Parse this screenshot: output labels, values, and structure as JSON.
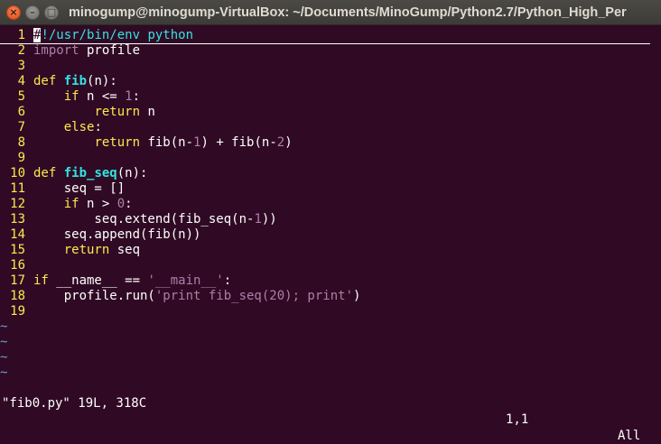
{
  "window": {
    "title": "minogump@minogump-VirtualBox: ~/Documents/MinoGump/Python2.7/Python_High_Per",
    "close_glyph": "×",
    "min_glyph": "–",
    "max_glyph": "□"
  },
  "editor": {
    "lines": [
      {
        "n": "1",
        "segs": [
          {
            "t": "#",
            "c": "cursor"
          },
          {
            "t": "!/usr/bin/env python",
            "c": "comment"
          }
        ]
      },
      {
        "n": "2",
        "segs": [
          {
            "t": "import",
            "c": "kw2"
          },
          {
            "t": " profile",
            "c": ""
          }
        ]
      },
      {
        "n": "3",
        "segs": []
      },
      {
        "n": "4",
        "segs": [
          {
            "t": "def",
            "c": "kw"
          },
          {
            "t": " ",
            "c": ""
          },
          {
            "t": "fib",
            "c": "fn"
          },
          {
            "t": "(n):",
            "c": ""
          }
        ]
      },
      {
        "n": "5",
        "segs": [
          {
            "t": "    ",
            "c": ""
          },
          {
            "t": "if",
            "c": "kw"
          },
          {
            "t": " n <= ",
            "c": ""
          },
          {
            "t": "1",
            "c": "num"
          },
          {
            "t": ":",
            "c": ""
          }
        ]
      },
      {
        "n": "6",
        "segs": [
          {
            "t": "        ",
            "c": ""
          },
          {
            "t": "return",
            "c": "kw"
          },
          {
            "t": " n",
            "c": ""
          }
        ]
      },
      {
        "n": "7",
        "segs": [
          {
            "t": "    ",
            "c": ""
          },
          {
            "t": "else",
            "c": "kw"
          },
          {
            "t": ":",
            "c": ""
          }
        ]
      },
      {
        "n": "8",
        "segs": [
          {
            "t": "        ",
            "c": ""
          },
          {
            "t": "return",
            "c": "kw"
          },
          {
            "t": " fib(n-",
            "c": ""
          },
          {
            "t": "1",
            "c": "num"
          },
          {
            "t": ") + fib(n-",
            "c": ""
          },
          {
            "t": "2",
            "c": "num"
          },
          {
            "t": ")",
            "c": ""
          }
        ]
      },
      {
        "n": "9",
        "segs": []
      },
      {
        "n": "10",
        "segs": [
          {
            "t": "def",
            "c": "kw"
          },
          {
            "t": " ",
            "c": ""
          },
          {
            "t": "fib_seq",
            "c": "fn"
          },
          {
            "t": "(n):",
            "c": ""
          }
        ]
      },
      {
        "n": "11",
        "segs": [
          {
            "t": "    seq = []",
            "c": ""
          }
        ]
      },
      {
        "n": "12",
        "segs": [
          {
            "t": "    ",
            "c": ""
          },
          {
            "t": "if",
            "c": "kw"
          },
          {
            "t": " n > ",
            "c": ""
          },
          {
            "t": "0",
            "c": "num"
          },
          {
            "t": ":",
            "c": ""
          }
        ]
      },
      {
        "n": "13",
        "segs": [
          {
            "t": "        seq.extend(fib_seq(n-",
            "c": ""
          },
          {
            "t": "1",
            "c": "num"
          },
          {
            "t": "))",
            "c": ""
          }
        ]
      },
      {
        "n": "14",
        "segs": [
          {
            "t": "    seq.append(fib(n))",
            "c": ""
          }
        ]
      },
      {
        "n": "15",
        "segs": [
          {
            "t": "    ",
            "c": ""
          },
          {
            "t": "return",
            "c": "kw"
          },
          {
            "t": " seq",
            "c": ""
          }
        ]
      },
      {
        "n": "16",
        "segs": []
      },
      {
        "n": "17",
        "segs": [
          {
            "t": "if",
            "c": "kw"
          },
          {
            "t": " __name__ == ",
            "c": ""
          },
          {
            "t": "'__main__'",
            "c": "str"
          },
          {
            "t": ":",
            "c": ""
          }
        ]
      },
      {
        "n": "18",
        "segs": [
          {
            "t": "    profile.run(",
            "c": ""
          },
          {
            "t": "'print fib_seq(20); print'",
            "c": "str"
          },
          {
            "t": ")",
            "c": ""
          }
        ]
      },
      {
        "n": "19",
        "segs": []
      }
    ],
    "tildes": [
      "~",
      "~",
      "~",
      "~"
    ]
  },
  "statusbar": {
    "file_info": "\"fib0.py\" 19L, 318C",
    "position": "1,1",
    "scroll": "All"
  },
  "colors": {
    "background": "#300a24",
    "line_number": "#fce94f",
    "keyword": "#fce94f",
    "function_name": "#34e2e2",
    "string_number": "#ad7fa8",
    "tilde": "#729fcf"
  }
}
